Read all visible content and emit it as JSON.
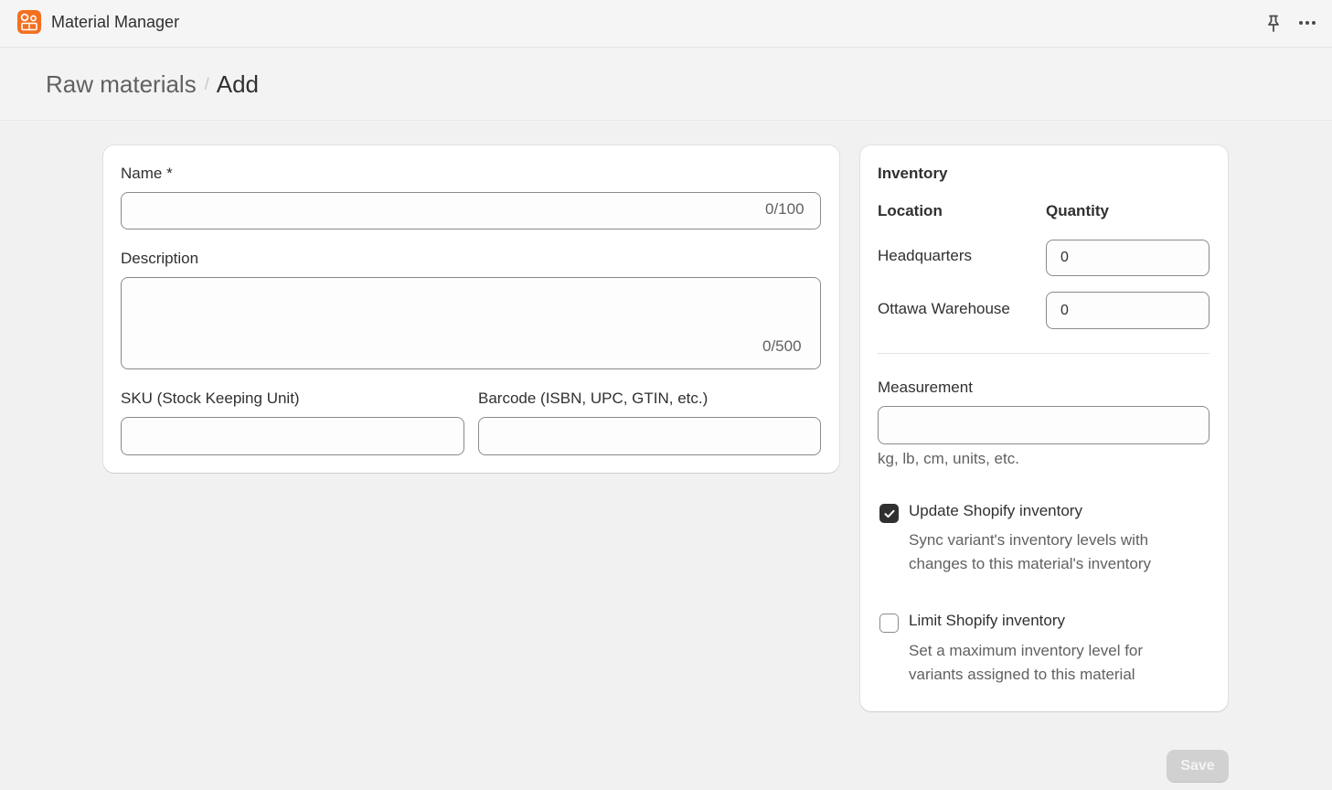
{
  "app": {
    "title": "Material Manager"
  },
  "breadcrumb": {
    "parent": "Raw materials",
    "separator": "/",
    "current": "Add"
  },
  "form": {
    "name": {
      "label": "Name *",
      "value": "",
      "counter": "0/100"
    },
    "description": {
      "label": "Description",
      "value": "",
      "counter": "0/500"
    },
    "sku": {
      "label": "SKU (Stock Keeping Unit)",
      "value": ""
    },
    "barcode": {
      "label": "Barcode (ISBN, UPC, GTIN, etc.)",
      "value": ""
    }
  },
  "inventory": {
    "title": "Inventory",
    "location_header": "Location",
    "quantity_header": "Quantity",
    "locations": [
      {
        "name": "Headquarters",
        "quantity": "0"
      },
      {
        "name": "Ottawa Warehouse",
        "quantity": "0"
      }
    ],
    "measurement": {
      "label": "Measurement",
      "value": "",
      "hint": "kg, lb, cm, units, etc."
    },
    "update_shopify": {
      "label": "Update Shopify inventory",
      "checked": true,
      "description": "Sync variant's inventory levels with changes to this material's inventory"
    },
    "limit_shopify": {
      "label": "Limit Shopify inventory",
      "checked": false,
      "description": "Set a maximum inventory level for variants assigned to this material"
    }
  },
  "actions": {
    "save_label": "Save"
  },
  "colors": {
    "brand": "#f37021",
    "background": "#f1f1f1",
    "checkbox_checked": "#303030",
    "save_disabled": "#d1d1d1"
  },
  "icons": {
    "app": "app-logo-icon",
    "pin": "pin-icon",
    "more": "more-horizontal-icon",
    "check": "checkmark-icon"
  }
}
